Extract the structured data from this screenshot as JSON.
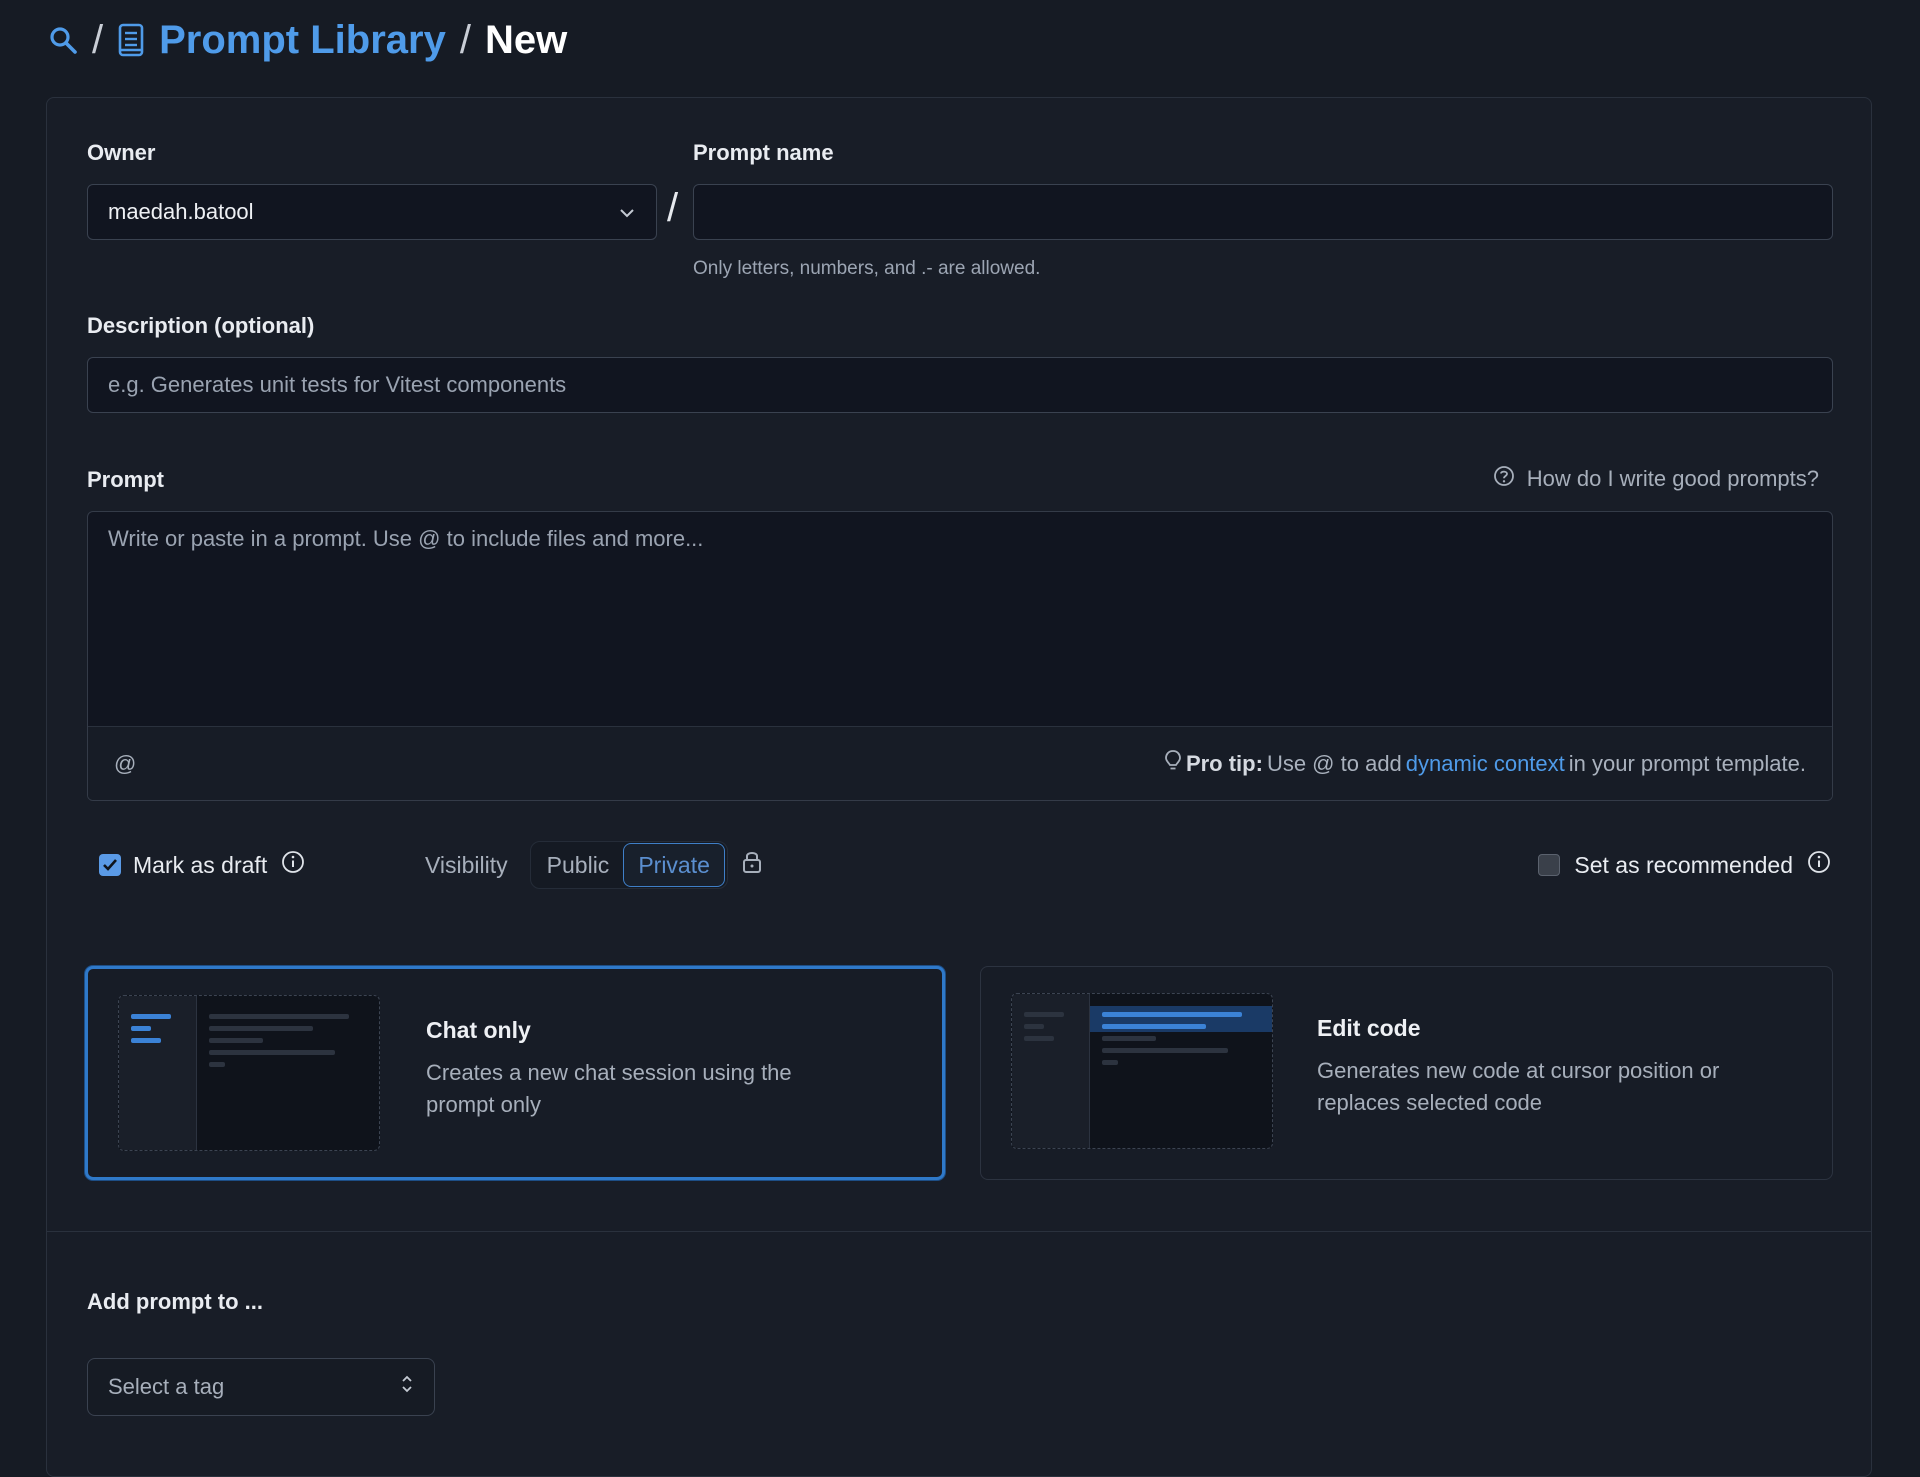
{
  "breadcrumb": {
    "search_icon": "search-icon",
    "separator": "/",
    "library_icon": "book-icon",
    "library_label": "Prompt Library",
    "current": "New"
  },
  "form": {
    "owner": {
      "label": "Owner",
      "value": "maedah.batool"
    },
    "slash": "/",
    "prompt_name": {
      "label": "Prompt name",
      "value": "",
      "hint": "Only letters, numbers, and .- are allowed."
    },
    "description": {
      "label": "Description (optional)",
      "placeholder": "e.g. Generates unit tests for Vitest components"
    },
    "prompt": {
      "label": "Prompt",
      "help_link": "How do I write good prompts?",
      "placeholder": "Write or paste in a prompt. Use @ to include files and more...",
      "at_symbol": "@",
      "pro_tip_label": "Pro tip:",
      "pro_tip_text_1": "Use @ to add",
      "pro_tip_link": "dynamic context",
      "pro_tip_text_2": "in your prompt template."
    },
    "options": {
      "mark_as_draft": "Mark as draft",
      "mark_as_draft_checked": true,
      "visibility_label": "Visibility",
      "visibility_public": "Public",
      "visibility_private": "Private",
      "visibility_selected": "Private",
      "set_as_recommended": "Set as recommended",
      "set_as_recommended_checked": false
    },
    "modes": [
      {
        "title": "Chat only",
        "description": "Creates a new chat session using the prompt only",
        "selected": true
      },
      {
        "title": "Edit code",
        "description": "Generates new code at cursor position or replaces selected code",
        "selected": false
      }
    ],
    "add_to": {
      "label": "Add prompt to ...",
      "tag_placeholder": "Select a tag"
    }
  },
  "colors": {
    "background": "#161b24",
    "accent": "#4f9be9",
    "selected_border": "#2f79c9"
  }
}
